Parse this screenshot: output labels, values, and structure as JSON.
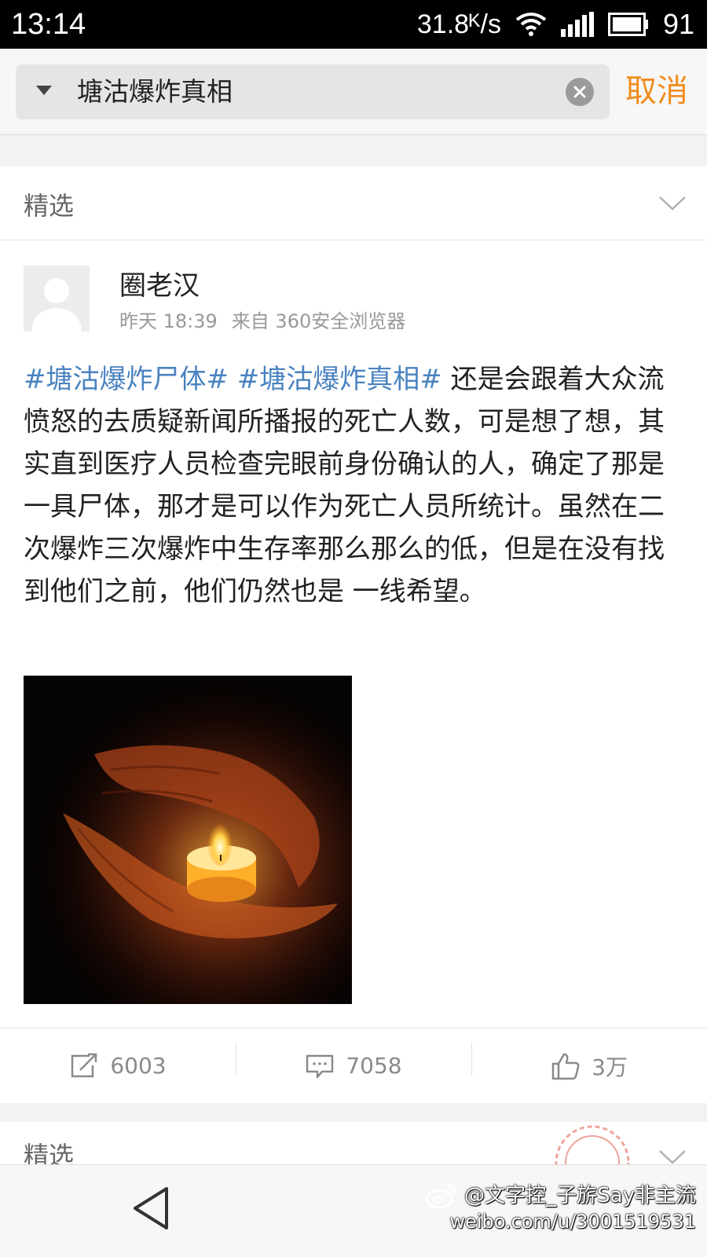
{
  "status_bar": {
    "time": "13:14",
    "net_speed": "31.8ᴷ/s",
    "battery_level": "91"
  },
  "search": {
    "query": "塘沽爆炸真相",
    "cancel_label": "取消"
  },
  "card": {
    "section_label": "精选",
    "author": "圈老汉",
    "timestamp": "昨天 18:39",
    "source": "来自 360安全浏览器",
    "hashtags": [
      "#塘沽爆炸尸体#",
      "#塘沽爆炸真相#"
    ],
    "body": "还是会跟着大众流愤怒的去质疑新闻所播报的死亡人数，可是想了想，其实直到医疗人员检查完眼前身份确认的人，确定了那是一具尸体，那才是可以作为死亡人员所统计。虽然在二次爆炸三次爆炸中生存率那么那么的低，但是在没有找到他们之前，他们仍然也是 一线希望。",
    "actions": {
      "repost_count": "6003",
      "comment_count": "7058",
      "like_count": "3万"
    }
  },
  "next_card": {
    "section_label": "精选"
  },
  "watermark": {
    "user": "@文字控_子旂Say非主流",
    "url": "weibo.com/u/3001519531"
  },
  "colors": {
    "accent": "#f08c1e",
    "hashtag": "#4a83c0"
  }
}
